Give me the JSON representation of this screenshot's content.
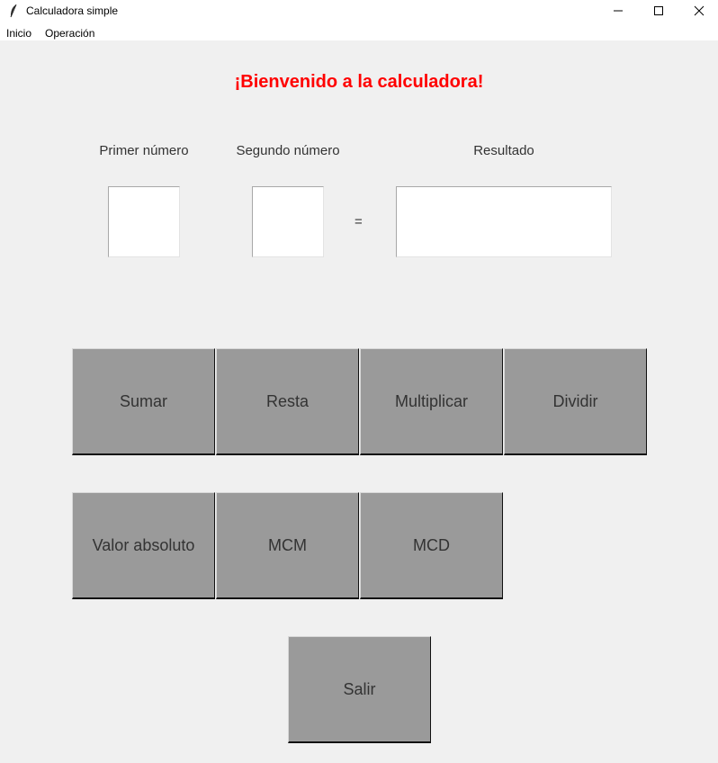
{
  "window": {
    "title": "Calculadora simple",
    "app_icon": "feather-icon",
    "controls": [
      "minimize-icon",
      "maximize-icon",
      "close-icon"
    ]
  },
  "menu": {
    "items": [
      {
        "label": "Inicio"
      },
      {
        "label": "Operación"
      }
    ]
  },
  "main": {
    "welcome": "¡Bienvenido a la calculadora!",
    "welcome_color": "#ff0000",
    "labels": {
      "first": "Primer número",
      "second": "Segundo número",
      "result": "Resultado"
    },
    "inputs": {
      "first_value": "",
      "second_value": "",
      "result_value": ""
    },
    "equals": "="
  },
  "buttons": {
    "sumar": "Sumar",
    "resta": "Resta",
    "multiplicar": "Multiplicar",
    "dividir": "Dividir",
    "valor_absoluto": "Valor absoluto",
    "mcm": "MCM",
    "mcd": "MCD",
    "salir": "Salir",
    "background": "#9a9a9a"
  }
}
